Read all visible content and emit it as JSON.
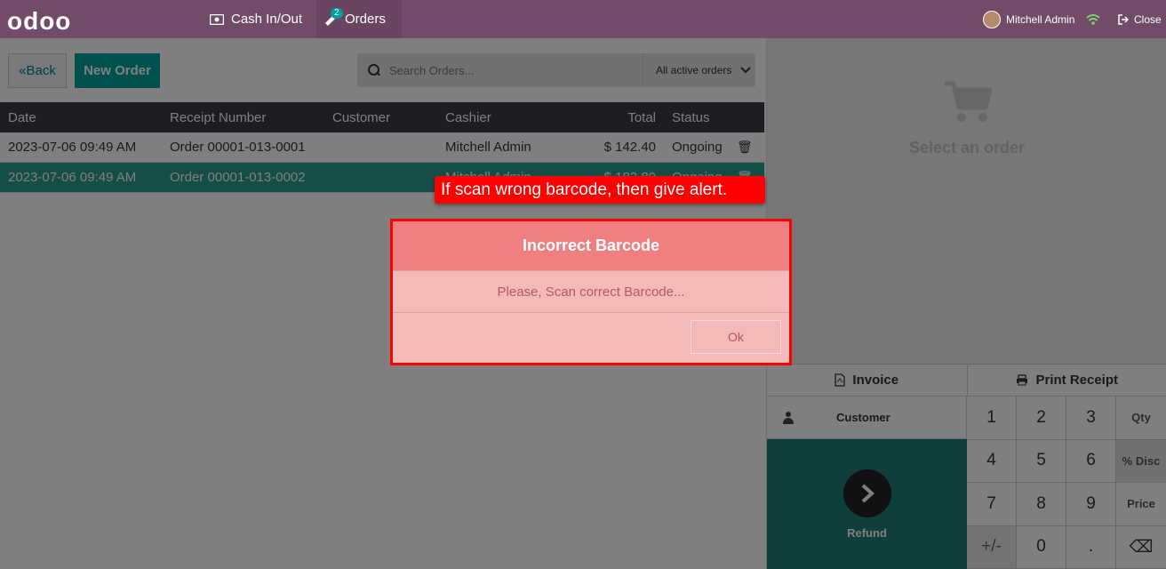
{
  "topbar": {
    "logo": "odoo",
    "cash_label": "Cash In/Out",
    "orders_label": "Orders",
    "orders_badge": "2",
    "user_name": "Mitchell Admin",
    "close_label": "Close"
  },
  "toolbar": {
    "back_label": "Back",
    "new_order_label": "New Order",
    "search_placeholder": "Search Orders...",
    "filter_label": "All active orders"
  },
  "table": {
    "headers": {
      "date": "Date",
      "receipt": "Receipt Number",
      "customer": "Customer",
      "cashier": "Cashier",
      "total": "Total",
      "status": "Status"
    },
    "rows": [
      {
        "date": "2023-07-06 09:49 AM",
        "receipt": "Order 00001-013-0001",
        "customer": "",
        "cashier": "Mitchell Admin",
        "total": "$ 142.40",
        "status": "Ongoing",
        "selected": false
      },
      {
        "date": "2023-07-06 09:49 AM",
        "receipt": "Order 00001-013-0002",
        "customer": "",
        "cashier": "Mitchell Admin",
        "total": "$ 182.80",
        "status": "Ongoing",
        "selected": true
      }
    ]
  },
  "right_panel": {
    "empty_text": "Select an order",
    "invoice_label": "Invoice",
    "print_label": "Print Receipt",
    "customer_label": "Customer",
    "refund_label": "Refund",
    "keys": [
      "1",
      "2",
      "3",
      "Qty",
      "4",
      "5",
      "6",
      "% Disc",
      "7",
      "8",
      "9",
      "Price",
      "+/-",
      "0",
      ".",
      "⌫"
    ]
  },
  "callout": {
    "text": "If scan wrong barcode, then give alert."
  },
  "dialog": {
    "title": "Incorrect Barcode",
    "body": "Please, Scan correct Barcode...",
    "ok_label": "Ok"
  },
  "colors": {
    "topbar": "#714b67",
    "accent": "#00a09d",
    "alert_red": "#ff0000",
    "dialog_header": "#f08080"
  }
}
